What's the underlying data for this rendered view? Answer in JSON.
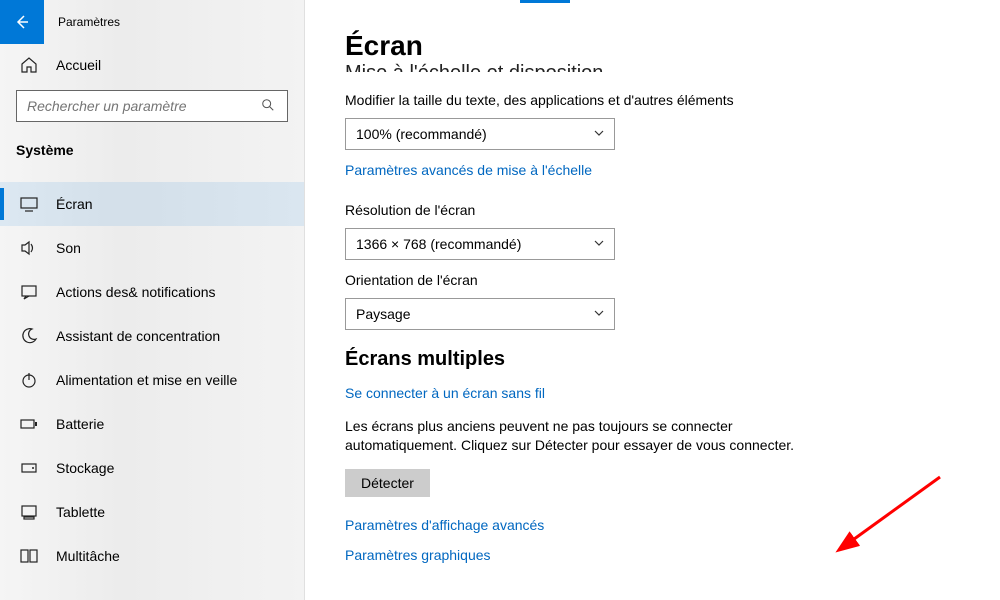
{
  "app_title": "Paramètres",
  "home_label": "Accueil",
  "search_placeholder": "Rechercher un paramètre",
  "section_label": "Système",
  "nav": {
    "items": [
      {
        "label": "Écran"
      },
      {
        "label": "Son"
      },
      {
        "label": "Actions des& notifications"
      },
      {
        "label": "Assistant de concentration"
      },
      {
        "label": "Alimentation et mise en veille"
      },
      {
        "label": "Batterie"
      },
      {
        "label": "Stockage"
      },
      {
        "label": "Tablette"
      },
      {
        "label": "Multitâche"
      }
    ]
  },
  "page": {
    "title": "Écran",
    "cut_heading": "Mise à l'échelle et disposition",
    "scale_label": "Modifier la taille du texte, des applications et d'autres éléments",
    "scale_value": "100% (recommandé)",
    "scale_advanced_link": "Paramètres avancés de mise à l'échelle",
    "resolution_label": "Résolution de l'écran",
    "resolution_value": "1366 × 768 (recommandé)",
    "orientation_label": "Orientation de l'écran",
    "orientation_value": "Paysage",
    "multiple_heading": "Écrans multiples",
    "wireless_link": "Se connecter à un écran sans fil",
    "detect_text": "Les écrans plus anciens peuvent ne pas toujours se connecter automatiquement. Cliquez sur Détecter pour essayer de vous connecter.",
    "detect_button": "Détecter",
    "advanced_display_link": "Paramètres d'affichage avancés",
    "graphics_link": "Paramètres graphiques"
  }
}
